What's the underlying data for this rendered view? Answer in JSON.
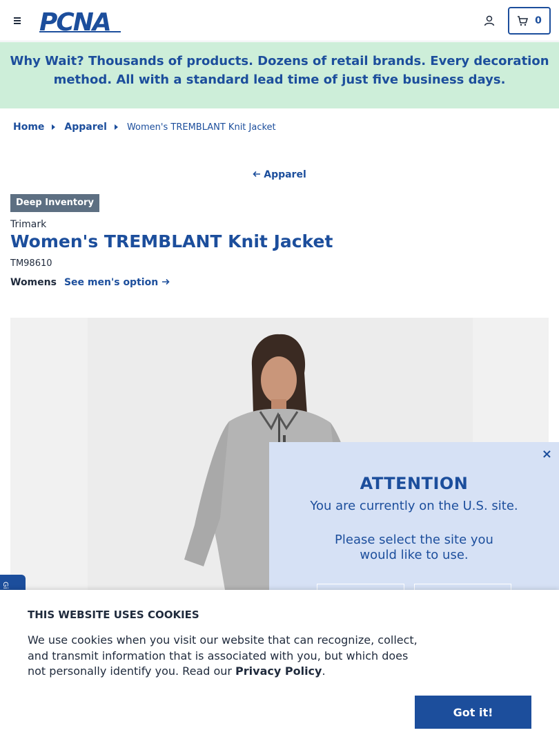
{
  "header": {
    "logo_text": "PCNA",
    "cart_count": "0"
  },
  "banner": {
    "text": "Why Wait? Thousands of products. Dozens of retail brands. Every decoration method. All with a standard lead time of just five business days."
  },
  "breadcrumb": {
    "items": [
      {
        "label": "Home"
      },
      {
        "label": "Apparel"
      }
    ],
    "current": "Women's TREMBLANT Knit Jacket"
  },
  "back_link": {
    "label": "Apparel"
  },
  "product": {
    "badge": "Deep Inventory",
    "brand": "Trimark",
    "title": "Women's TREMBLANT Knit Jacket",
    "sku": "TM98610",
    "gender_label": "Womens",
    "gender_link": "See men's option"
  },
  "feedback_tab": {
    "label": "Gi"
  },
  "modal": {
    "close": "×",
    "title": "ATTENTION",
    "line1": "You are currently on the U.S. site.",
    "line2": "Please select the site you would like to use."
  },
  "cookie": {
    "title": "THIS WEBSITE USES COOKIES",
    "text_before": "We use cookies when you visit our website that can recognize, collect, and transmit information that is associated with you, but which does not personally identify you. Read our ",
    "link": "Privacy Policy",
    "text_after": ".",
    "button": "Got it!"
  },
  "colors": {
    "primary": "#1c4e9c",
    "banner_bg": "#cdeed9",
    "badge_bg": "#5d6f82",
    "modal_bg": "#d6e1f5"
  }
}
